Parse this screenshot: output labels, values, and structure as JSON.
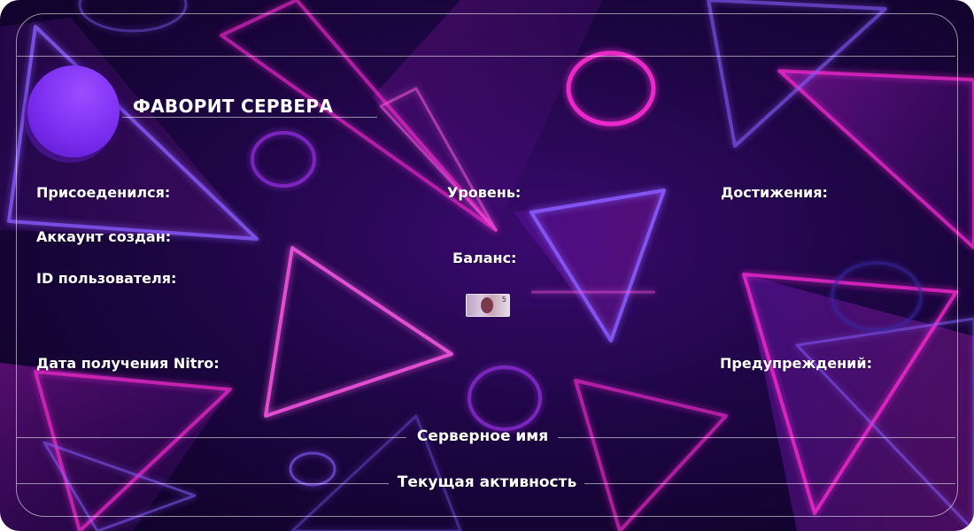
{
  "card": {
    "title": "ФАВОРИТ СЕРВЕРА",
    "colors": {
      "accent": "#9b4dff",
      "neon_pink": "#ff2bd6",
      "neon_violet": "#8a5cff",
      "background": "#1e0645"
    }
  },
  "fields": {
    "joined": "Присоеденился:",
    "account_created": "Аккаунт создан:",
    "user_id": "ID пользователя:",
    "nitro_date": "Дата получения Nitro:",
    "level": "Уровень:",
    "balance": "Баланс:",
    "achievements": "Достижения:",
    "warnings": "Предупреждений:"
  },
  "footer": {
    "server_name": "Серверное имя",
    "activity": "Текущая активность"
  },
  "icons": {
    "avatar": "avatar-circle",
    "currency": "banknote-icon",
    "banknote_number": "5"
  }
}
